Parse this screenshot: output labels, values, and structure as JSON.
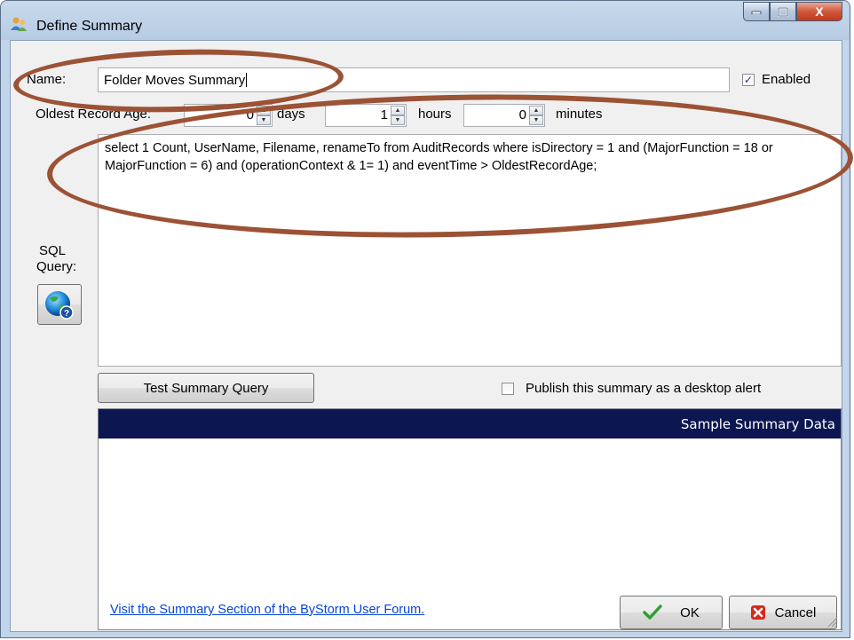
{
  "window": {
    "title": "Define Summary",
    "close_glyph": "X",
    "icons": {
      "app": "people-icon",
      "minimize": "minimize-icon",
      "maximize": "maximize-icon",
      "close": "close-icon"
    }
  },
  "form": {
    "name_label": "Name:",
    "name_value": "Folder Moves Summary",
    "enabled_label": "Enabled",
    "enabled_checked": true,
    "oldest_label": "Oldest Record Age:",
    "days_value": "0",
    "days_label": "days",
    "hours_value": "1",
    "hours_label": "hours",
    "minutes_value": "0",
    "minutes_label": "minutes",
    "sql_label_1": "SQL",
    "sql_label_2": "Query:",
    "sql_help_icon": "globe-help-icon",
    "query_text": "select 1 Count, UserName, Filename, renameTo from AuditRecords where isDirectory = 1 and (MajorFunction = 18 or MajorFunction = 6) and (operationContext & 1= 1) and eventTime > OldestRecordAge;",
    "test_button": "Test Summary Query",
    "publish_label": "Publish this summary as a desktop alert",
    "publish_checked": false
  },
  "grid": {
    "header": "Sample Summary Data"
  },
  "footer": {
    "link_text": "Visit the Summary Section of the ByStorm User Forum.",
    "ok_label": "OK",
    "cancel_label": "Cancel",
    "ok_icon": "checkmark-icon",
    "cancel_icon": "cancel-x-icon"
  },
  "colors": {
    "annotation": "#9c5235",
    "grid_header": "#0c1650",
    "link": "#0645d6"
  }
}
